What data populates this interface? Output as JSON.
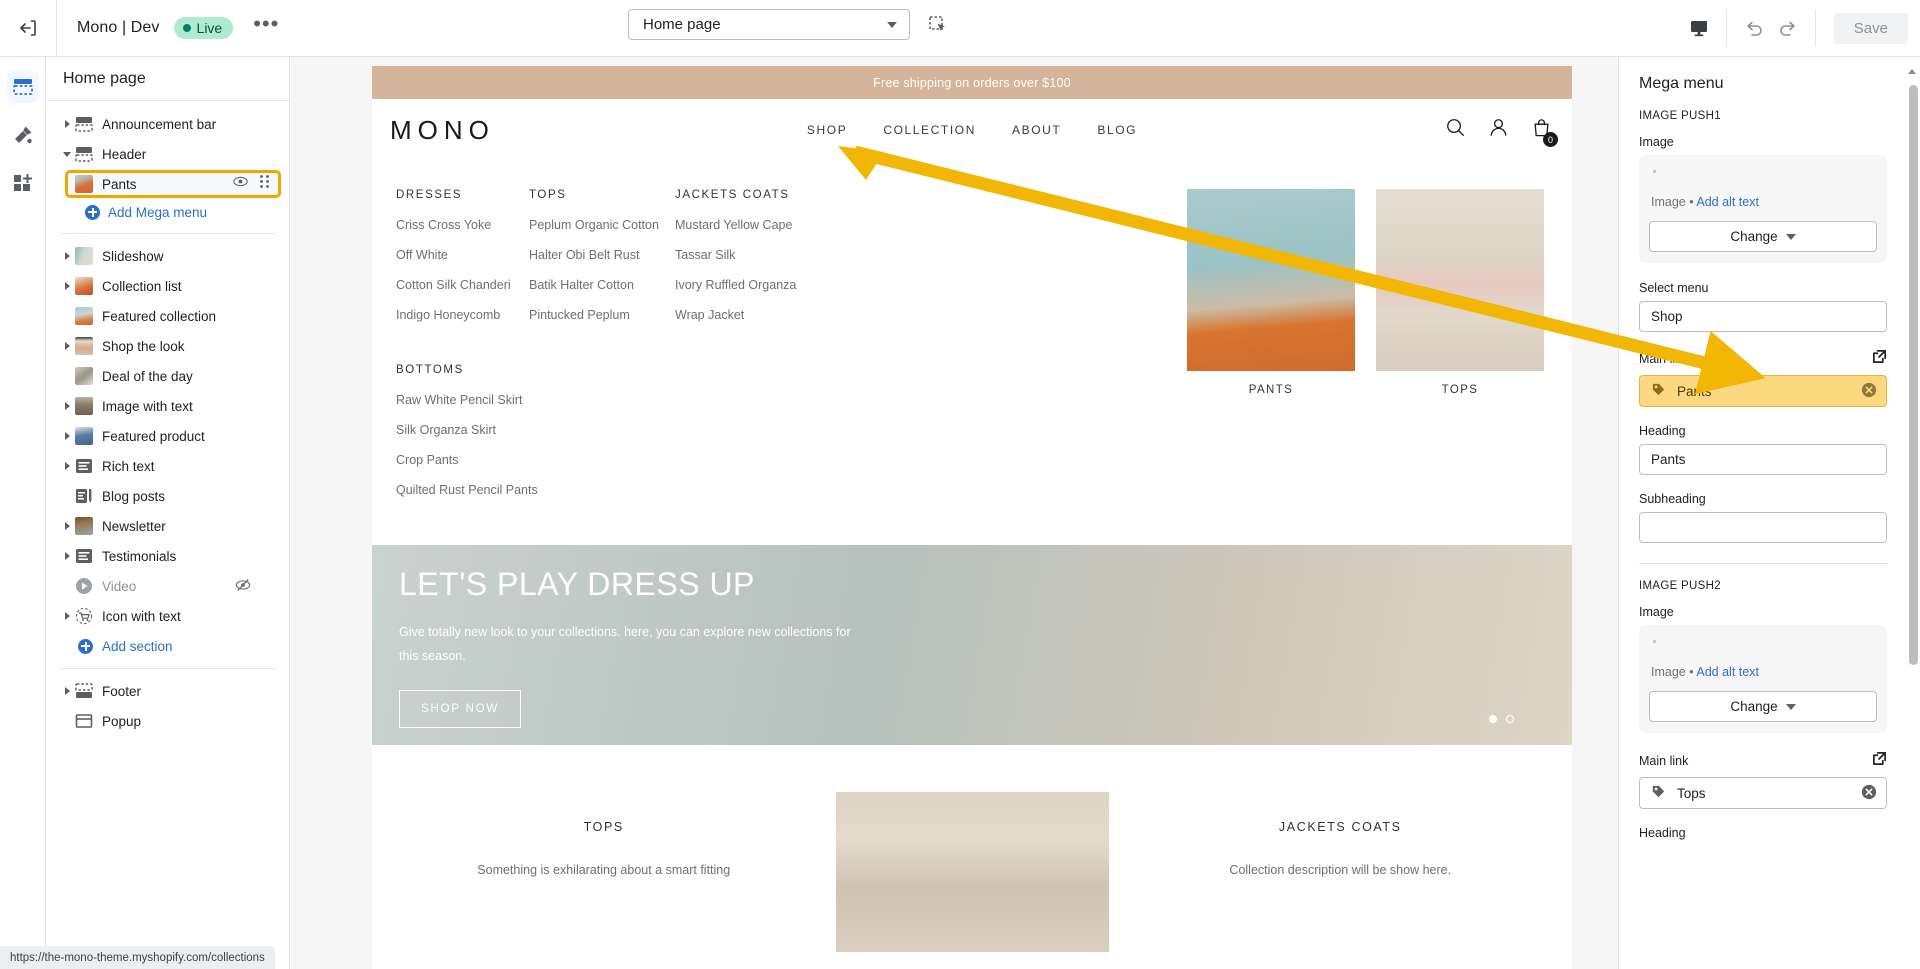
{
  "topbar": {
    "exit_icon": "exit-arrow-icon",
    "theme_name": "Mono | Dev",
    "live_badge": "Live",
    "more_label": "•••",
    "page_selector_value": "Home page",
    "inspect_icon": "inspector-select-icon",
    "device_icon": "desktop-icon",
    "undo_icon": "undo-icon",
    "redo_icon": "redo-icon",
    "save_label": "Save"
  },
  "rail": {
    "items": [
      {
        "name": "sections-icon",
        "active": true
      },
      {
        "name": "theme-settings-icon",
        "active": false
      },
      {
        "name": "apps-icon",
        "active": false
      }
    ]
  },
  "sidebar": {
    "header": "Home page",
    "items": [
      {
        "label": "Announcement bar",
        "expandable": true,
        "expanded": false,
        "icon": "announcement-bar-icon",
        "hidden": false
      },
      {
        "label": "Header",
        "expandable": true,
        "expanded": true,
        "icon": "header-icon",
        "hidden": false
      },
      {
        "label": "Slideshow",
        "expandable": true,
        "expanded": false,
        "icon": "slideshow-thumb",
        "hidden": false
      },
      {
        "label": "Collection list",
        "expandable": true,
        "expanded": false,
        "icon": "collection-list-thumb",
        "hidden": false
      },
      {
        "label": "Featured collection",
        "expandable": false,
        "expanded": false,
        "icon": "featured-collection-thumb",
        "hidden": false
      },
      {
        "label": "Shop the look",
        "expandable": true,
        "expanded": false,
        "icon": "shop-the-look-thumb",
        "hidden": false
      },
      {
        "label": "Deal of the day",
        "expandable": false,
        "expanded": false,
        "icon": "deal-of-the-day-thumb",
        "hidden": false
      },
      {
        "label": "Image with text",
        "expandable": true,
        "expanded": false,
        "icon": "image-with-text-thumb",
        "hidden": false
      },
      {
        "label": "Featured product",
        "expandable": true,
        "expanded": false,
        "icon": "featured-product-thumb",
        "hidden": false
      },
      {
        "label": "Rich text",
        "expandable": true,
        "expanded": false,
        "icon": "rich-text-icon",
        "hidden": false
      },
      {
        "label": "Blog posts",
        "expandable": false,
        "expanded": false,
        "icon": "blog-posts-icon",
        "hidden": false
      },
      {
        "label": "Newsletter",
        "expandable": true,
        "expanded": false,
        "icon": "newsletter-thumb",
        "hidden": false
      },
      {
        "label": "Testimonials",
        "expandable": true,
        "expanded": false,
        "icon": "testimonials-icon",
        "hidden": false
      },
      {
        "label": "Video",
        "expandable": false,
        "expanded": false,
        "icon": "video-icon",
        "hidden": true
      },
      {
        "label": "Icon with text",
        "expandable": true,
        "expanded": false,
        "icon": "icon-with-text-icon",
        "hidden": false
      }
    ],
    "header_child": {
      "label": "Pants",
      "selected": true,
      "eye_icon": "eye-icon",
      "drag_icon": "drag-handle-icon"
    },
    "add_mega_menu": "Add Mega menu",
    "add_section": "Add section",
    "footer_items": [
      {
        "label": "Footer",
        "expandable": true,
        "icon": "footer-icon"
      },
      {
        "label": "Popup",
        "expandable": false,
        "icon": "popup-icon"
      }
    ]
  },
  "preview": {
    "announcement": "Free shipping on orders over $100",
    "brand": "MONO",
    "nav": [
      {
        "label": "SHOP",
        "active": true
      },
      {
        "label": "COLLECTION",
        "active": false
      },
      {
        "label": "ABOUT",
        "active": false
      },
      {
        "label": "BLOG",
        "active": false
      }
    ],
    "header_icons": [
      {
        "name": "search-icon"
      },
      {
        "name": "account-icon"
      },
      {
        "name": "cart-icon",
        "badge": "0"
      }
    ],
    "mega_menu": {
      "columns": [
        {
          "heading": "DRESSES",
          "links": [
            "Criss Cross Yoke",
            "Off White",
            "Cotton Silk Chanderi",
            "Indigo Honeycomb"
          ]
        },
        {
          "heading": "TOPS",
          "links": [
            "Peplum Organic Cotton",
            "Halter Obi Belt Rust",
            "Batik Halter Cotton",
            "Pintucked Peplum"
          ]
        },
        {
          "heading": "JACKETS COATS",
          "links": [
            "Mustard Yellow Cape",
            "Tassar Silk",
            "Ivory Ruffled Organza",
            "Wrap Jacket"
          ]
        }
      ],
      "second_row": {
        "heading": "BOTTOMS",
        "links": [
          "Raw White Pencil Skirt",
          "Silk Organza Skirt",
          "Crop Pants",
          "Quilted Rust Pencil Pants"
        ]
      },
      "image_pushes": [
        {
          "caption": "PANTS"
        },
        {
          "caption": "TOPS"
        }
      ]
    },
    "hero": {
      "heading": "LET'S PLAY DRESS UP",
      "paragraph": "Give totally new look to your collections. here, you can explore new collections for this season.",
      "button": "SHOP NOW",
      "slides": 2,
      "active_slide": 1
    },
    "collection_list": [
      {
        "title": "TOPS",
        "description": "Something is exhilarating about a smart fitting"
      },
      {
        "title": "",
        "description": ""
      },
      {
        "title": "JACKETS COATS",
        "description": "Collection description will be show here."
      }
    ]
  },
  "right_panel": {
    "title": "Mega menu",
    "image_push1": {
      "section_label": "IMAGE PUSH1",
      "image_label": "Image",
      "image_meta_prefix": "Image • ",
      "image_alt_link": "Add alt text",
      "change_label": "Change"
    },
    "select_menu": {
      "label": "Select menu",
      "value": "Shop"
    },
    "main_link_1": {
      "label": "Main link",
      "value": "Pants",
      "external_icon": "external-link-icon",
      "clear_icon": "clear-circle-icon",
      "tag_icon": "tag-icon",
      "highlighted": true
    },
    "heading_1": {
      "label": "Heading",
      "value": "Pants"
    },
    "subheading_1": {
      "label": "Subheading",
      "value": ""
    },
    "image_push2": {
      "section_label": "IMAGE PUSH2",
      "image_label": "Image",
      "image_meta_prefix": "Image • ",
      "image_alt_link": "Add alt text",
      "change_label": "Change"
    },
    "main_link_2": {
      "label": "Main link",
      "value": "Tops",
      "external_icon": "external-link-icon",
      "clear_icon": "clear-circle-icon",
      "tag_icon": "tag-icon",
      "highlighted": false
    },
    "heading_2": {
      "label": "Heading"
    }
  },
  "statusbar": {
    "url": "https://the-mono-theme.myshopify.com/collections"
  },
  "colors": {
    "highlight_border": "#f0a800",
    "highlight_fill": "#fcd980",
    "link_blue": "#2c6ecb",
    "live_green": "#008060",
    "announcement_bg": "#d4b49a",
    "arrow_gold": "#f2b705"
  }
}
